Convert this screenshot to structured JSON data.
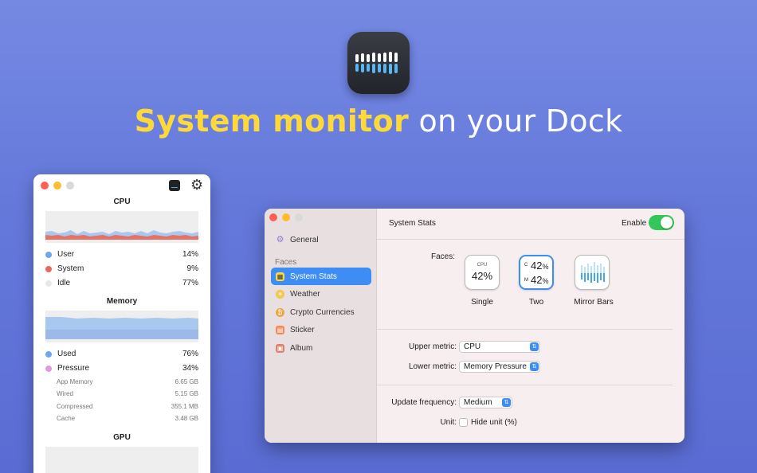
{
  "headline": {
    "accent": "System monitor",
    "rest": " on your Dock"
  },
  "left_window": {
    "cpu": {
      "title": "CPU",
      "rows": [
        {
          "label": "User",
          "value": "14%",
          "color": "#6aa9ee"
        },
        {
          "label": "System",
          "value": "9%",
          "color": "#e9675b"
        },
        {
          "label": "Idle",
          "value": "77%",
          "color": "#e8e8e8"
        }
      ]
    },
    "memory": {
      "title": "Memory",
      "rows": [
        {
          "label": "Used",
          "value": "76%",
          "color": "#6aa9ee"
        },
        {
          "label": "Pressure",
          "value": "34%",
          "color": "#e199e6"
        }
      ],
      "sub_rows": [
        {
          "label": "App Memory",
          "value": "6.65 GB"
        },
        {
          "label": "Wired",
          "value": "5.15 GB"
        },
        {
          "label": "Compressed",
          "value": "355.1 MB"
        },
        {
          "label": "Cache",
          "value": "3.48 GB"
        }
      ]
    },
    "gpu": {
      "title": "GPU"
    }
  },
  "main_window": {
    "sidebar": {
      "general": "General",
      "section_label": "Faces",
      "items": [
        "System Stats",
        "Weather",
        "Crypto Currencies",
        "Sticker",
        "Album"
      ]
    },
    "header": {
      "title": "System Stats",
      "enable_label": "Enable"
    },
    "faces": {
      "label": "Faces:",
      "single": {
        "caption": "Single",
        "top": "CPU",
        "value": "42%"
      },
      "two": {
        "caption": "Two",
        "c_label": "C",
        "m_label": "M",
        "c_value": "42",
        "m_value": "42",
        "unit": "%"
      },
      "mirror": {
        "caption": "Mirror Bars"
      }
    },
    "form": {
      "upper_label": "Upper metric:",
      "upper_value": "CPU",
      "lower_label": "Lower metric:",
      "lower_value": "Memory Pressure",
      "freq_label": "Update frequency:",
      "freq_value": "Medium",
      "unit_label": "Unit:",
      "unit_option": "Hide unit (%)"
    }
  }
}
